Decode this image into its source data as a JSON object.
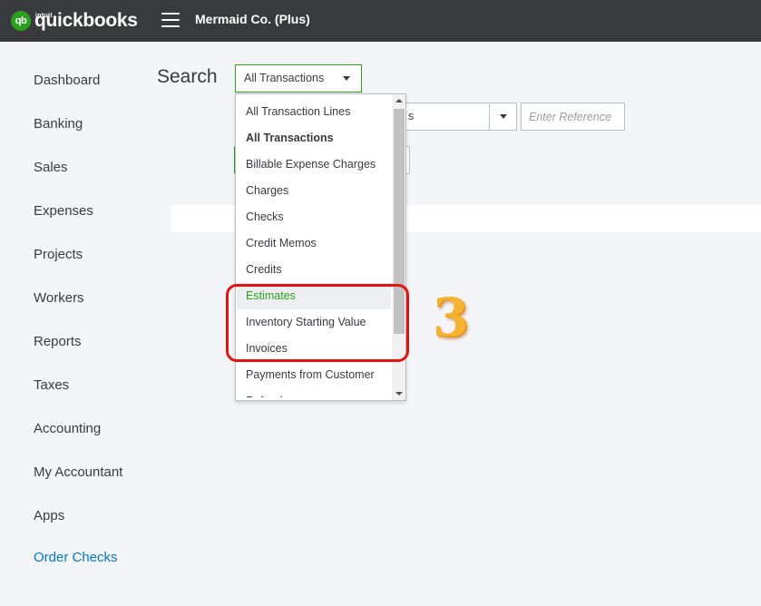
{
  "app": {
    "logo_intuit": "intuit",
    "logo_text": "quickbooks",
    "logo_badge": "qb",
    "company_name": "Mermaid Co. (Plus)"
  },
  "sidebar": {
    "items": [
      {
        "label": "Dashboard"
      },
      {
        "label": "Banking"
      },
      {
        "label": "Sales"
      },
      {
        "label": "Expenses"
      },
      {
        "label": "Projects"
      },
      {
        "label": "Workers"
      },
      {
        "label": "Reports"
      },
      {
        "label": "Taxes"
      },
      {
        "label": "Accounting"
      },
      {
        "label": "My Accountant"
      },
      {
        "label": "Apps"
      },
      {
        "label": "Order Checks"
      }
    ]
  },
  "search": {
    "title": "Search",
    "type_selected": "All Transactions",
    "filter_partial": "s",
    "reference_placeholder": "Enter Reference"
  },
  "dropdown": {
    "options": [
      {
        "label": "All Transaction Lines"
      },
      {
        "label": "All Transactions"
      },
      {
        "label": "Billable Expense Charges"
      },
      {
        "label": "Charges"
      },
      {
        "label": "Checks"
      },
      {
        "label": "Credit Memos"
      },
      {
        "label": "Credits"
      },
      {
        "label": "Estimates"
      },
      {
        "label": "Inventory Starting Value"
      },
      {
        "label": "Invoices"
      },
      {
        "label": "Payments from Customer"
      },
      {
        "label": "Refund"
      }
    ],
    "selected_index": 1,
    "hover_index": 7
  },
  "annotation": {
    "step": "3",
    "highlight_color": "#e31313",
    "step_color": "#f6b331"
  },
  "colors": {
    "topbar": "#393a3d",
    "brand_green": "#2ca01c",
    "link_blue": "#0077c5"
  }
}
